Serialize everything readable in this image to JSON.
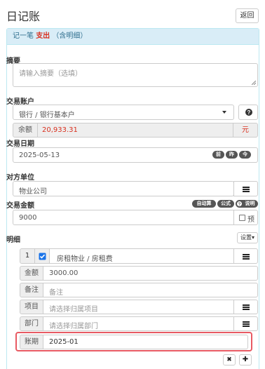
{
  "header": {
    "title": "日记账",
    "back_label": "返回"
  },
  "panel": {
    "prefix": "记一笔",
    "type": "支出",
    "suffix": "（含明细）"
  },
  "summary": {
    "label": "摘要",
    "placeholder": "请输入摘要（选填）"
  },
  "account": {
    "label": "交易账户",
    "value": "银行 / 银行基本户",
    "balance_label": "余额",
    "balance_value": "20,933.31",
    "currency": "元"
  },
  "date": {
    "label": "交易日期",
    "value": "2025-05-13",
    "btn_prev": "前",
    "btn_yesterday": "昨",
    "btn_today": "今"
  },
  "counterparty": {
    "label": "对方单位",
    "value": "物业公司"
  },
  "amount": {
    "label": "交易金额",
    "value": "9000",
    "auto_calc": "自动算",
    "formula": "公式",
    "help": "说明",
    "prepay_label": "预"
  },
  "detail": {
    "label": "明细",
    "settings": "设置▾",
    "index": "1",
    "category": "房租物业 / 房租费",
    "amount_label": "金额",
    "amount_value": "3000.00",
    "note_label": "备注",
    "note_placeholder": "备注",
    "project_label": "项目",
    "project_placeholder": "请选择归属项目",
    "dept_label": "部门",
    "dept_placeholder": "请选择归属部门",
    "period_label": "账期",
    "period_value": "2025-01",
    "remove_symbol": "✖",
    "add_symbol": "✚"
  },
  "colors": {
    "accent_red": "#d9301f",
    "highlight_border": "#e85a63",
    "panel_head_bg": "#d9edf7",
    "checkbox_blue": "#1a73e8"
  }
}
